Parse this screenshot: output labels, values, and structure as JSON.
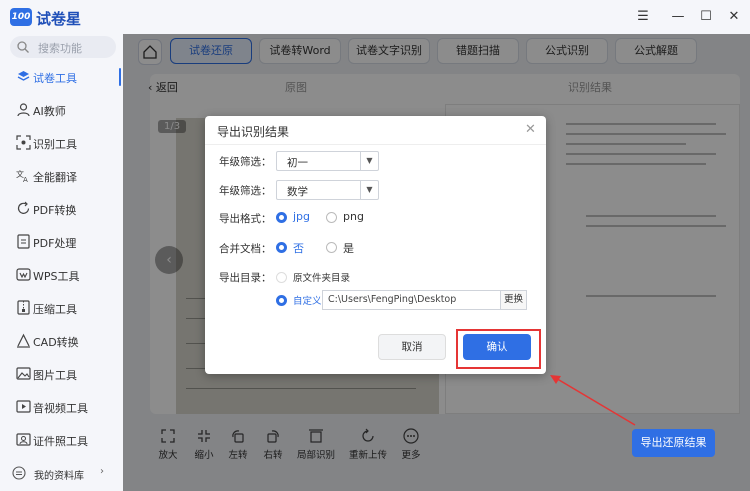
{
  "app": {
    "name": "试卷星",
    "logo_text": "100"
  },
  "window": {
    "menu_icon": "hamburger-icon",
    "minimize_icon": "minimize-icon",
    "maximize_icon": "maximize-icon",
    "close_icon": "close-icon"
  },
  "sidebar": {
    "search_placeholder": "搜索功能",
    "items": [
      {
        "label": "试卷工具",
        "icon": "layers-icon",
        "active": true
      },
      {
        "label": "AI教师",
        "icon": "user-icon"
      },
      {
        "label": "识别工具",
        "icon": "scan-icon"
      },
      {
        "label": "全能翻译",
        "icon": "translate-icon"
      },
      {
        "label": "PDF转换",
        "icon": "refresh-icon"
      },
      {
        "label": "PDF处理",
        "icon": "pdf-icon"
      },
      {
        "label": "WPS工具",
        "icon": "wps-icon"
      },
      {
        "label": "压缩工具",
        "icon": "compress-icon"
      },
      {
        "label": "CAD转换",
        "icon": "cad-icon"
      },
      {
        "label": "图片工具",
        "icon": "image-icon"
      },
      {
        "label": "音视频工具",
        "icon": "media-icon"
      },
      {
        "label": "证件照工具",
        "icon": "id-photo-icon"
      }
    ],
    "footer": {
      "label": "我的资料库",
      "chevron": "›"
    }
  },
  "tabs": [
    {
      "label": "试卷还原",
      "active": true
    },
    {
      "label": "试卷转Word"
    },
    {
      "label": "试卷文字识别"
    },
    {
      "label": "错题扫描"
    },
    {
      "label": "公式识别"
    },
    {
      "label": "公式解题"
    }
  ],
  "content": {
    "back_label": "返回",
    "original_label": "原图",
    "result_label": "识别结果",
    "page_indicator": "1/3"
  },
  "toolbar": [
    {
      "label": "放大",
      "icon": "expand-icon"
    },
    {
      "label": "缩小",
      "icon": "shrink-icon"
    },
    {
      "label": "左转",
      "icon": "rotate-left-icon"
    },
    {
      "label": "右转",
      "icon": "rotate-right-icon"
    },
    {
      "label": "局部识别",
      "icon": "crop-icon"
    },
    {
      "label": "重新上传",
      "icon": "reupload-icon"
    },
    {
      "label": "更多",
      "icon": "more-icon"
    }
  ],
  "export_button": "导出还原结果",
  "dialog": {
    "title": "导出识别结果",
    "grade_label": "年级筛选：",
    "grade_value": "初一",
    "subject_label": "年级筛选：",
    "subject_value": "数学",
    "format_label": "导出格式：",
    "format_options": [
      "jpg",
      "png"
    ],
    "format_selected": "jpg",
    "merge_label": "合并文档：",
    "merge_options": [
      "否",
      "是"
    ],
    "merge_selected": "否",
    "dir_label": "导出目录：",
    "dir_option_source": "原文件夹目录",
    "dir_option_custom": "自定义",
    "dir_path": "C:\\Users\\FengPing\\Desktop",
    "change_label": "更换",
    "cancel_label": "取消",
    "confirm_label": "确认"
  },
  "colors": {
    "accent": "#2f6fe4",
    "highlight": "#e53535"
  }
}
